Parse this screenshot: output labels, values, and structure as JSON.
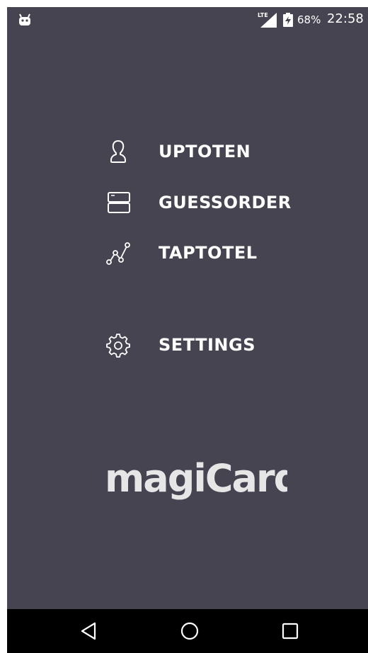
{
  "status_bar": {
    "network_label": "LTE",
    "battery_percent": "68%",
    "time": "22:58",
    "notification_icon": "android-icon",
    "signal_icon": "lte-signal-icon",
    "battery_icon": "battery-charging-icon"
  },
  "menu": {
    "items": [
      {
        "label": "UPTOTEN",
        "icon": "person-icon"
      },
      {
        "label": "GUESSORDER",
        "icon": "stacked-cards-icon"
      },
      {
        "label": "TAPTOTEL",
        "icon": "connected-nodes-icon"
      },
      {
        "label": "SETTINGS",
        "icon": "gear-icon"
      }
    ]
  },
  "logo": {
    "text": "magiCard"
  },
  "nav_bar": {
    "icons": [
      "back-triangle-icon",
      "home-circle-icon",
      "recents-square-icon"
    ]
  },
  "colors": {
    "background": "#474452",
    "text": "#ffffff",
    "nav_bar": "#000000",
    "logo": "#e6e6e6"
  }
}
